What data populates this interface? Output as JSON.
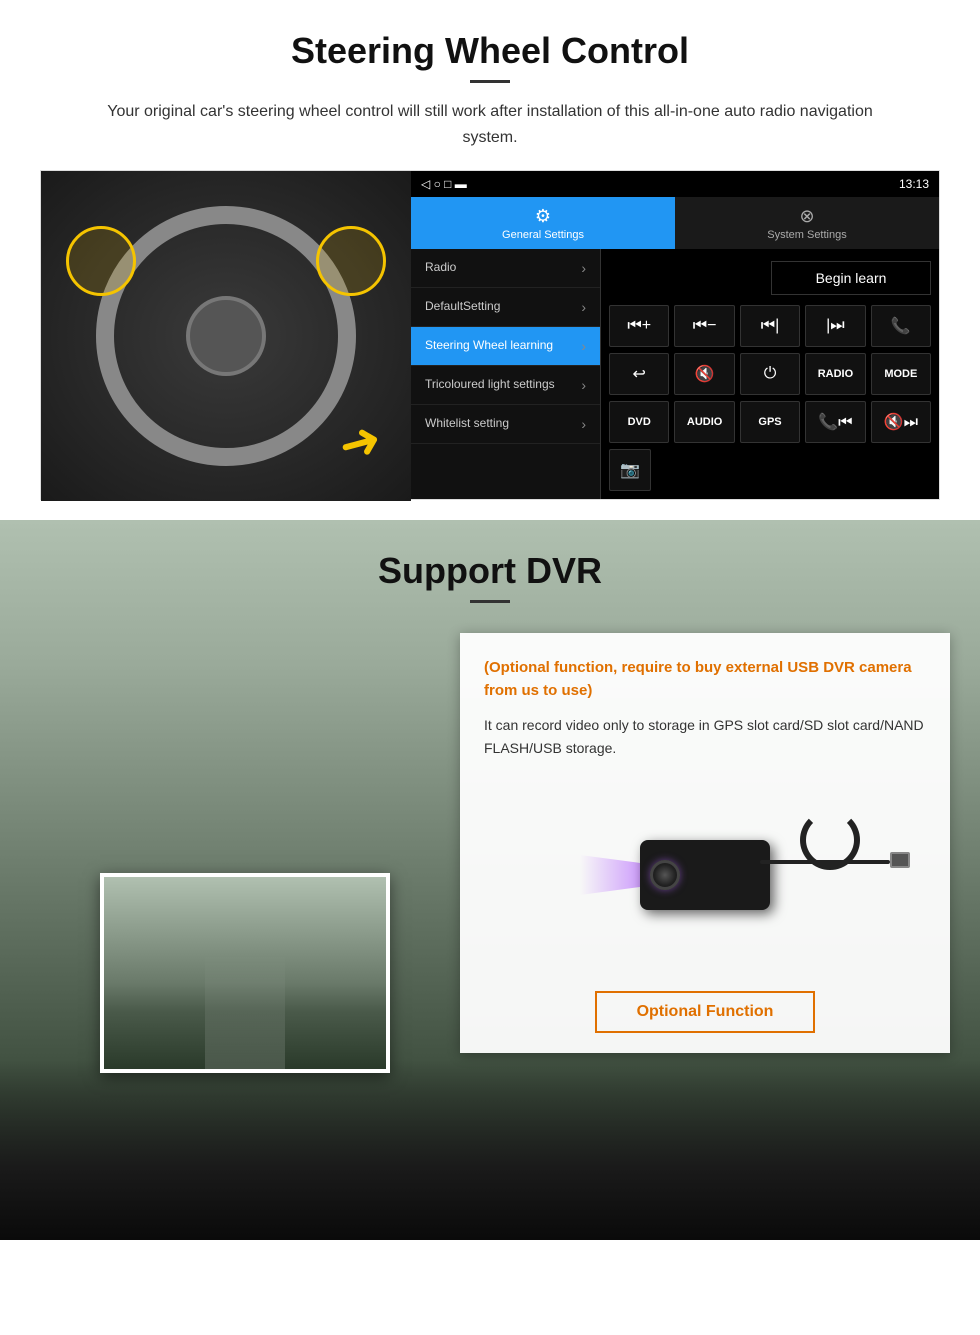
{
  "steering": {
    "title": "Steering Wheel Control",
    "description": "Your original car's steering wheel control will still work after installation of this all-in-one auto radio navigation system.",
    "android": {
      "statusbar": {
        "time": "13:13",
        "icons": "▼ ◀"
      },
      "tabs": [
        {
          "label": "General Settings",
          "icon": "⚙",
          "active": true
        },
        {
          "label": "System Settings",
          "icon": "🌐",
          "active": false
        }
      ],
      "menu_items": [
        {
          "label": "Radio",
          "active": false
        },
        {
          "label": "DefaultSetting",
          "active": false
        },
        {
          "label": "Steering Wheel learning",
          "active": true
        },
        {
          "label": "Tricoloured light settings",
          "active": false
        },
        {
          "label": "Whitelist setting",
          "active": false
        }
      ],
      "begin_learn": "Begin learn",
      "control_rows": [
        [
          "⏮+",
          "⏮−",
          "⏮|",
          "|⏭",
          "📞"
        ],
        [
          "↩",
          "🔇",
          "⏻",
          "RADIO",
          "MODE"
        ],
        [
          "DVD",
          "AUDIO",
          "GPS",
          "📞⏮|",
          "🔇⏭|"
        ],
        [
          "📷"
        ]
      ]
    }
  },
  "dvr": {
    "title": "Support DVR",
    "optional_text": "(Optional function, require to buy external USB DVR camera from us to use)",
    "description": "It can record video only to storage in GPS slot card/SD slot card/NAND FLASH/USB storage.",
    "optional_btn": "Optional Function"
  }
}
